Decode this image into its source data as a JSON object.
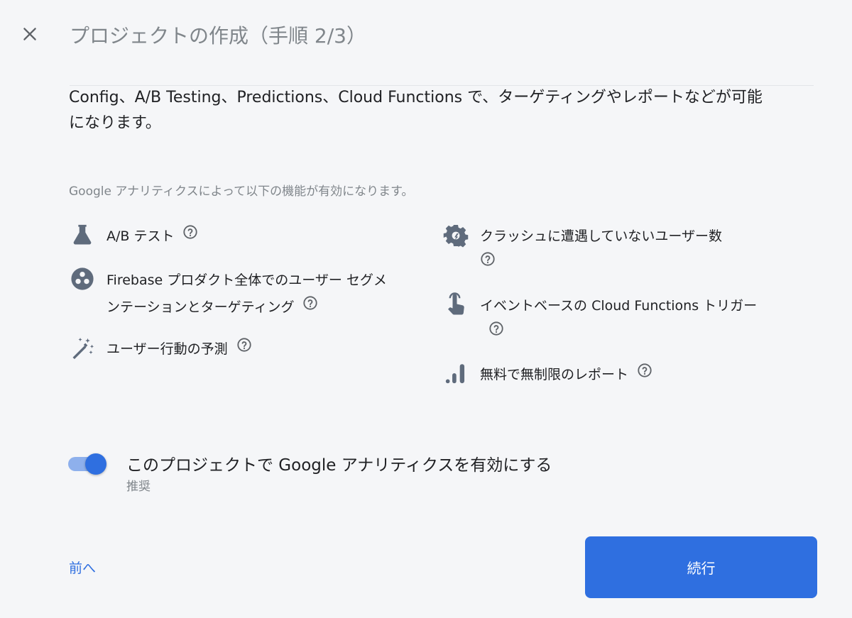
{
  "header": {
    "close_icon": "close-icon",
    "title": "プロジェクトの作成（手順 2/3）"
  },
  "intro": {
    "text": "Config、A/B Testing、Predictions、Cloud Functions で、ターゲティングやレポートなどが可能になります。"
  },
  "analytics": {
    "caption": "Google アナリティクスによって以下の機能が有効になります。",
    "features_left": [
      {
        "icon": "flask-icon",
        "label": "A/B テスト"
      },
      {
        "icon": "segment-icon",
        "label": "Firebase プロダクト全体でのユーザー セグメンテーションとターゲティング"
      },
      {
        "icon": "magic-wand-icon",
        "label": "ユーザー行動の予測"
      }
    ],
    "features_right": [
      {
        "icon": "gear-cog-icon",
        "label": "クラッシュに遭遇していないユーザー数"
      },
      {
        "icon": "touch-hand-icon",
        "label": "イベントベースの Cloud Functions トリガー"
      },
      {
        "icon": "bar-chart-icon",
        "label": "無料で無制限のレポート"
      }
    ]
  },
  "toggle": {
    "label": "このプロジェクトで Google アナリティクスを有効にする",
    "sublabel": "推奨",
    "enabled": true
  },
  "footer": {
    "back_label": "前へ",
    "continue_label": "続行"
  },
  "colors": {
    "accent": "#2f6fe0",
    "icon": "#5f6b7c",
    "muted_text": "#80868b",
    "background": "#f5f6f8"
  }
}
